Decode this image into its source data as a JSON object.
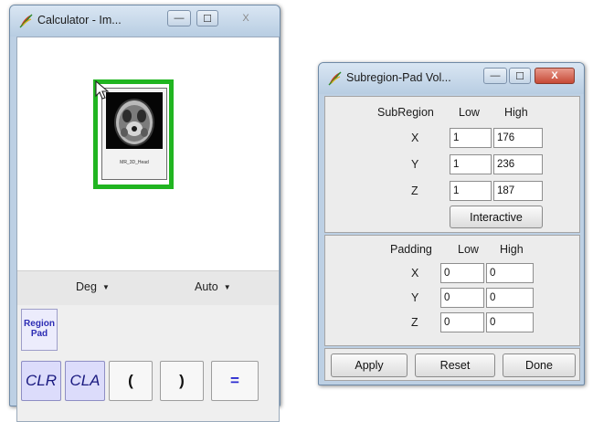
{
  "calculator": {
    "title": "Calculator - Im...",
    "thumbnail_label": "MR_3D_Head",
    "angle_mode": "Deg",
    "format_mode": "Auto",
    "region_pad_line1": "Region",
    "region_pad_line2": "Pad",
    "keys": [
      "CLR",
      "CLA",
      "(",
      ")",
      "="
    ]
  },
  "subregion": {
    "title": "Subregion-Pad Vol...",
    "subregion_header": "SubRegion",
    "low_header": "Low",
    "high_header": "High",
    "rows": [
      {
        "axis": "X",
        "low": "1",
        "high": "176"
      },
      {
        "axis": "Y",
        "low": "1",
        "high": "236"
      },
      {
        "axis": "Z",
        "low": "1",
        "high": "187"
      }
    ],
    "interactive_label": "Interactive",
    "padding_header": "Padding",
    "padding_rows": [
      {
        "axis": "X",
        "low": "0",
        "high": "0"
      },
      {
        "axis": "Y",
        "low": "0",
        "high": "0"
      },
      {
        "axis": "Z",
        "low": "0",
        "high": "0"
      }
    ],
    "apply_label": "Apply",
    "reset_label": "Reset",
    "done_label": "Done"
  },
  "window_controls": {
    "minimize": "—",
    "maximize": "☐",
    "close": "X",
    "close_ghost": "X"
  },
  "icons": {
    "app_icon": "feather-app-icon",
    "cursor": "mouse-pointer-icon",
    "dropdown": "caret-down-icon"
  },
  "colors": {
    "selection_border": "#21b521",
    "region_text": "#2c2cb3",
    "clr_key_bg": "#dcdcfb"
  }
}
